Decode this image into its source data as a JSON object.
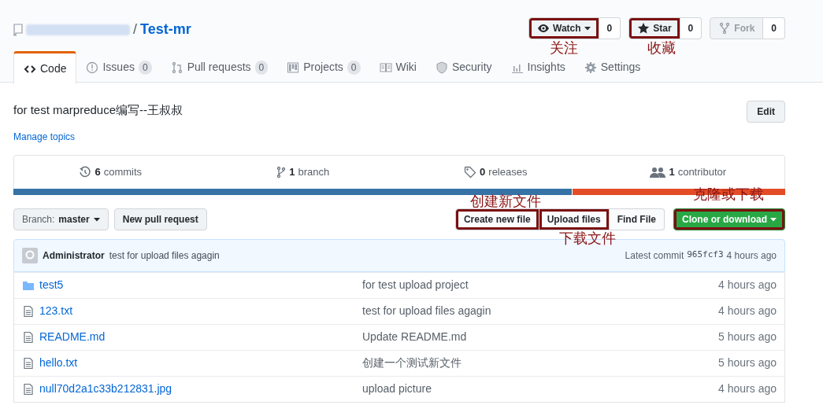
{
  "repo": {
    "separator": "/",
    "name": "Test-mr"
  },
  "header_buttons": [
    {
      "kind": "watch",
      "label": "Watch",
      "count": "0",
      "highlighted": true,
      "disabled": false
    },
    {
      "kind": "star",
      "label": "Star",
      "count": "0",
      "highlighted": true,
      "disabled": false
    },
    {
      "kind": "fork",
      "label": "Fork",
      "count": "0",
      "highlighted": false,
      "disabled": true
    }
  ],
  "tabs": [
    {
      "kind": "code",
      "label": "Code",
      "selected": true
    },
    {
      "kind": "issues",
      "label": "Issues",
      "count": "0",
      "selected": false
    },
    {
      "kind": "pulls",
      "label": "Pull requests",
      "count": "0",
      "selected": false
    },
    {
      "kind": "projects",
      "label": "Projects",
      "count": "0",
      "selected": false
    },
    {
      "kind": "wiki",
      "label": "Wiki",
      "selected": false
    },
    {
      "kind": "security",
      "label": "Security",
      "selected": false
    },
    {
      "kind": "insights",
      "label": "Insights",
      "selected": false
    },
    {
      "kind": "settings",
      "label": "Settings",
      "selected": false
    }
  ],
  "description": "for test marpreduce编写--王叔叔",
  "edit_button": "Edit",
  "manage_topics": "Manage topics",
  "stats": [
    {
      "kind": "commits",
      "number": "6",
      "label": "commits"
    },
    {
      "kind": "branch",
      "number": "1",
      "label": "branch"
    },
    {
      "kind": "releases",
      "number": "0",
      "label": "releases"
    },
    {
      "kind": "contributors",
      "number": "1",
      "label": "contributor"
    }
  ],
  "languages": [
    {
      "color": "#3572a5",
      "level": 0.724
    },
    {
      "color": "#e34c26",
      "level": 0.276
    }
  ],
  "branch_button": {
    "label": "Branch:",
    "value": "master"
  },
  "new_pull_request": "New pull request",
  "file_buttons": [
    {
      "kind": "plain",
      "label": "Create new file",
      "highlighted": true
    },
    {
      "kind": "plain",
      "label": "Upload files",
      "highlighted": true
    },
    {
      "kind": "plain",
      "label": "Find File",
      "highlighted": false
    },
    {
      "kind": "primary",
      "label": "Clone or download",
      "highlighted": true
    }
  ],
  "latest_commit": {
    "author": "Administrator",
    "message": "test for upload files agagin",
    "prefix": "Latest commit",
    "sha": "965fcf3",
    "time": "4 hours ago"
  },
  "files": [
    {
      "kind": "folder",
      "name": "test5",
      "message": "for test upload project",
      "age": "4 hours ago"
    },
    {
      "kind": "file",
      "name": "123.txt",
      "message": "test for upload files agagin",
      "age": "4 hours ago"
    },
    {
      "kind": "file",
      "name": "README.md",
      "message": "Update README.md",
      "age": "5 hours ago"
    },
    {
      "kind": "file",
      "name": "hello.txt",
      "message": "创建一个测试新文件",
      "age": "5 hours ago"
    },
    {
      "kind": "file",
      "name": "null70d2a1c33b212831.jpg",
      "message": "upload picture",
      "age": "4 hours ago"
    }
  ],
  "annotations": [
    "关注",
    "收藏",
    "创建新文件",
    "下载文件",
    "克隆或下载"
  ]
}
